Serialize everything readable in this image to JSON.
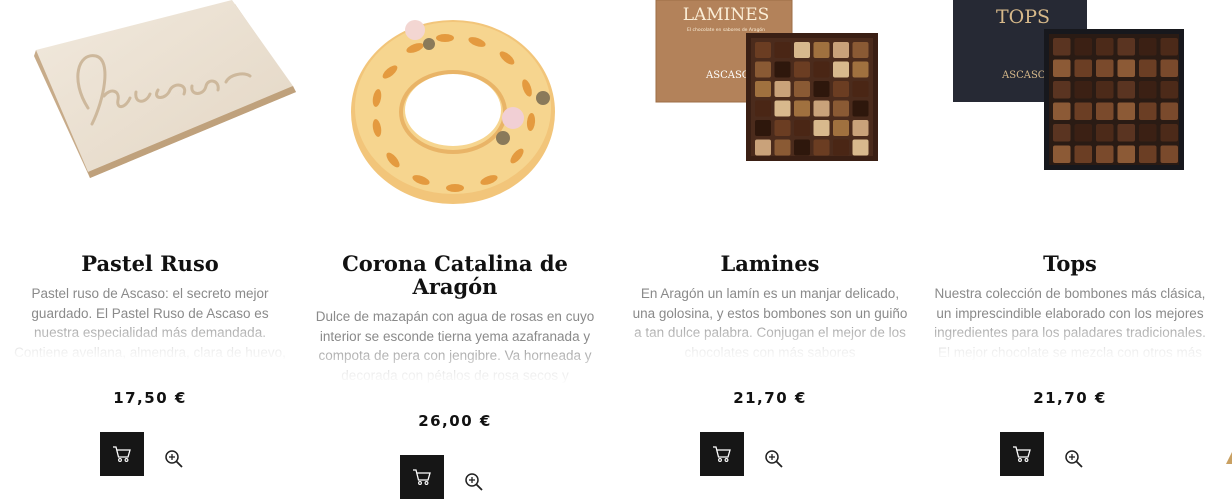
{
  "currency_symbol": "€",
  "products": [
    {
      "title": "Pastel Ruso",
      "description": "Pastel ruso de Ascaso: el secreto mejor guardado. El Pastel Ruso de Ascaso es nuestra especialidad más demandada. Contiene avellana, almendra, clara de huevo, azúcar de",
      "price": "17,50 €",
      "image_icon": "pastel-ruso-cake-image"
    },
    {
      "title": "Corona Catalina de Aragón",
      "description": "Dulce de mazapán con agua de rosas en cuyo interior se esconde tierna yema azafranada y compota de pera con jengibre. Va horneada y decorada con pétalos de rosa secos y",
      "price": "26,00 €",
      "image_icon": "corona-cake-image"
    },
    {
      "title": "Lamines",
      "description": "En Aragón un lamín es un manjar delicado, una golosina, y estos bombones son un guiño a tan dulce palabra. Conjugan el mejor de los chocolates con más sabores",
      "price": "21,70 €",
      "image_icon": "lamines-chocolate-box-image",
      "box_brand": "LAMINES",
      "box_tagline": "El chocolate en sabores de Aragón",
      "box_maker": "ASCASO"
    },
    {
      "title": "Tops",
      "description": "Nuestra colección de bombones más clásica, un imprescindible elaborado con los mejores ingredientes para los paladares tradicionales. El mejor chocolate se mezcla con otros más",
      "price": "21,70 €",
      "image_icon": "tops-chocolate-box-image",
      "box_brand": "TOPS",
      "box_maker": "ASCASO"
    }
  ],
  "actions": {
    "cart_icon": "cart-icon",
    "zoom_icon": "zoom-in-icon"
  },
  "colors": {
    "title": "#111111",
    "description": "#8a8a8a",
    "button_bg": "#161616",
    "accent": "#c9a062"
  }
}
